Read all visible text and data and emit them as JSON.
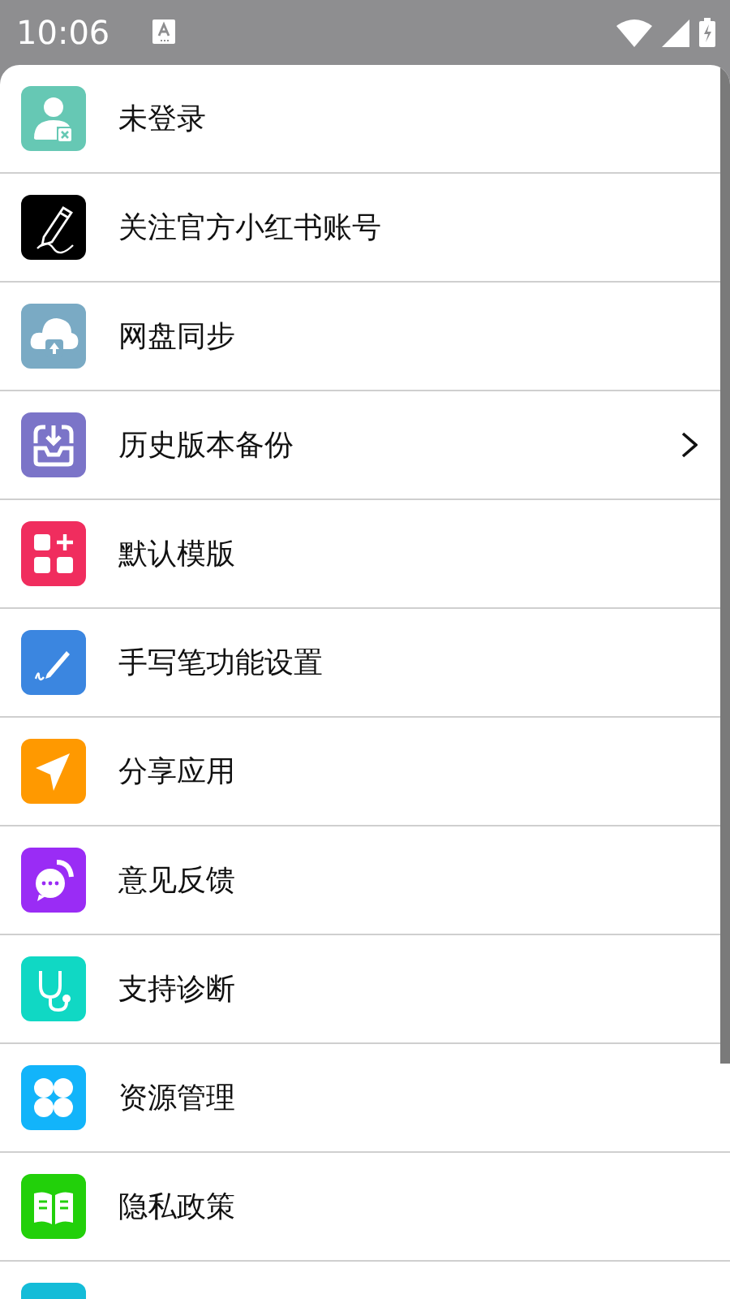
{
  "status_bar": {
    "time": "10:06"
  },
  "menu": {
    "items": [
      {
        "label": "未登录",
        "color": "#66c8b4",
        "submenu": false
      },
      {
        "label": "关注官方小红书账号",
        "color": "#000000",
        "submenu": false
      },
      {
        "label": "网盘同步",
        "color": "#7aaac4",
        "submenu": false
      },
      {
        "label": "历史版本备份",
        "color": "#7b74c8",
        "submenu": true
      },
      {
        "label": "默认模版",
        "color": "#f02d5e",
        "submenu": false
      },
      {
        "label": "手写笔功能设置",
        "color": "#3b86e0",
        "submenu": false
      },
      {
        "label": "分享应用",
        "color": "#ff9900",
        "submenu": false
      },
      {
        "label": "意见反馈",
        "color": "#9a2cf5",
        "submenu": false
      },
      {
        "label": "支持诊断",
        "color": "#10d8c4",
        "submenu": false
      },
      {
        "label": "资源管理",
        "color": "#12b4fa",
        "submenu": false
      },
      {
        "label": "隐私政策",
        "color": "#22d00a",
        "submenu": false
      },
      {
        "color": "#14bcd8",
        "submenu": false
      }
    ]
  }
}
